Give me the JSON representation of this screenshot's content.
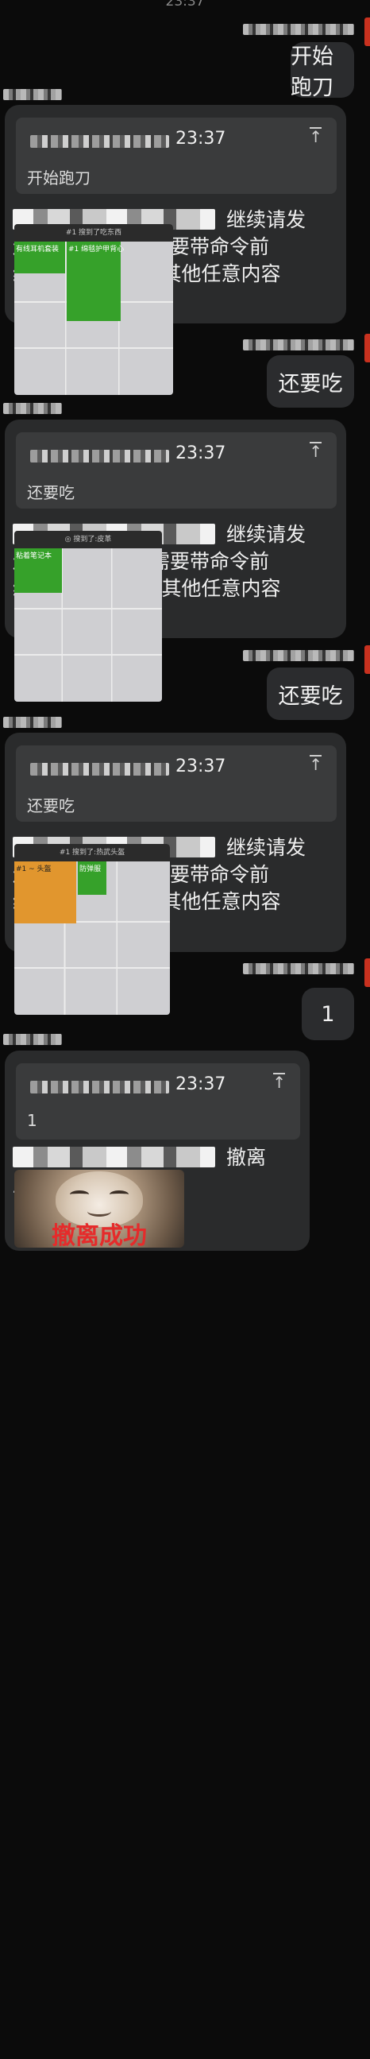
{
  "status_time": "23:37",
  "conversation": [
    {
      "out_text": "开始跑刀"
    },
    {
      "quote_time": "23:37",
      "quote_text": "开始跑刀",
      "reply_text": "继续请发送\"还要吃\"（不需要带命令前缀），撤离则发送其他任意内容",
      "grid_title": "#1 搜到了吃东西",
      "cell_labels": [
        "有线耳机套装",
        "#1 绵毯护甲背心"
      ]
    },
    {
      "out_text": "还要吃"
    },
    {
      "quote_time": "23:37",
      "quote_text": "还要吃",
      "reply_text": "继续请发送\"还要吃\"（不需要带命令前缀），撤离则发送其他任意内容",
      "grid_title": "◎ 搜到了:皮革",
      "cell_labels": [
        "粘着笔记本"
      ]
    },
    {
      "out_text": "还要吃"
    },
    {
      "quote_time": "23:37",
      "quote_text": "还要吃",
      "reply_text": "继续请发送\"还要吃\"（不需要带命令前缀），撤离则发送其他任意内容",
      "grid_title": "#1 搜到了:热武头盔",
      "cell_labels": [
        "#1 ~ 头盔",
        "防弹服"
      ]
    },
    {
      "out_text": "1"
    },
    {
      "quote_time": "23:37",
      "quote_text": "1",
      "reply_text": "撤离成功",
      "image_caption": "撤离成功"
    }
  ]
}
